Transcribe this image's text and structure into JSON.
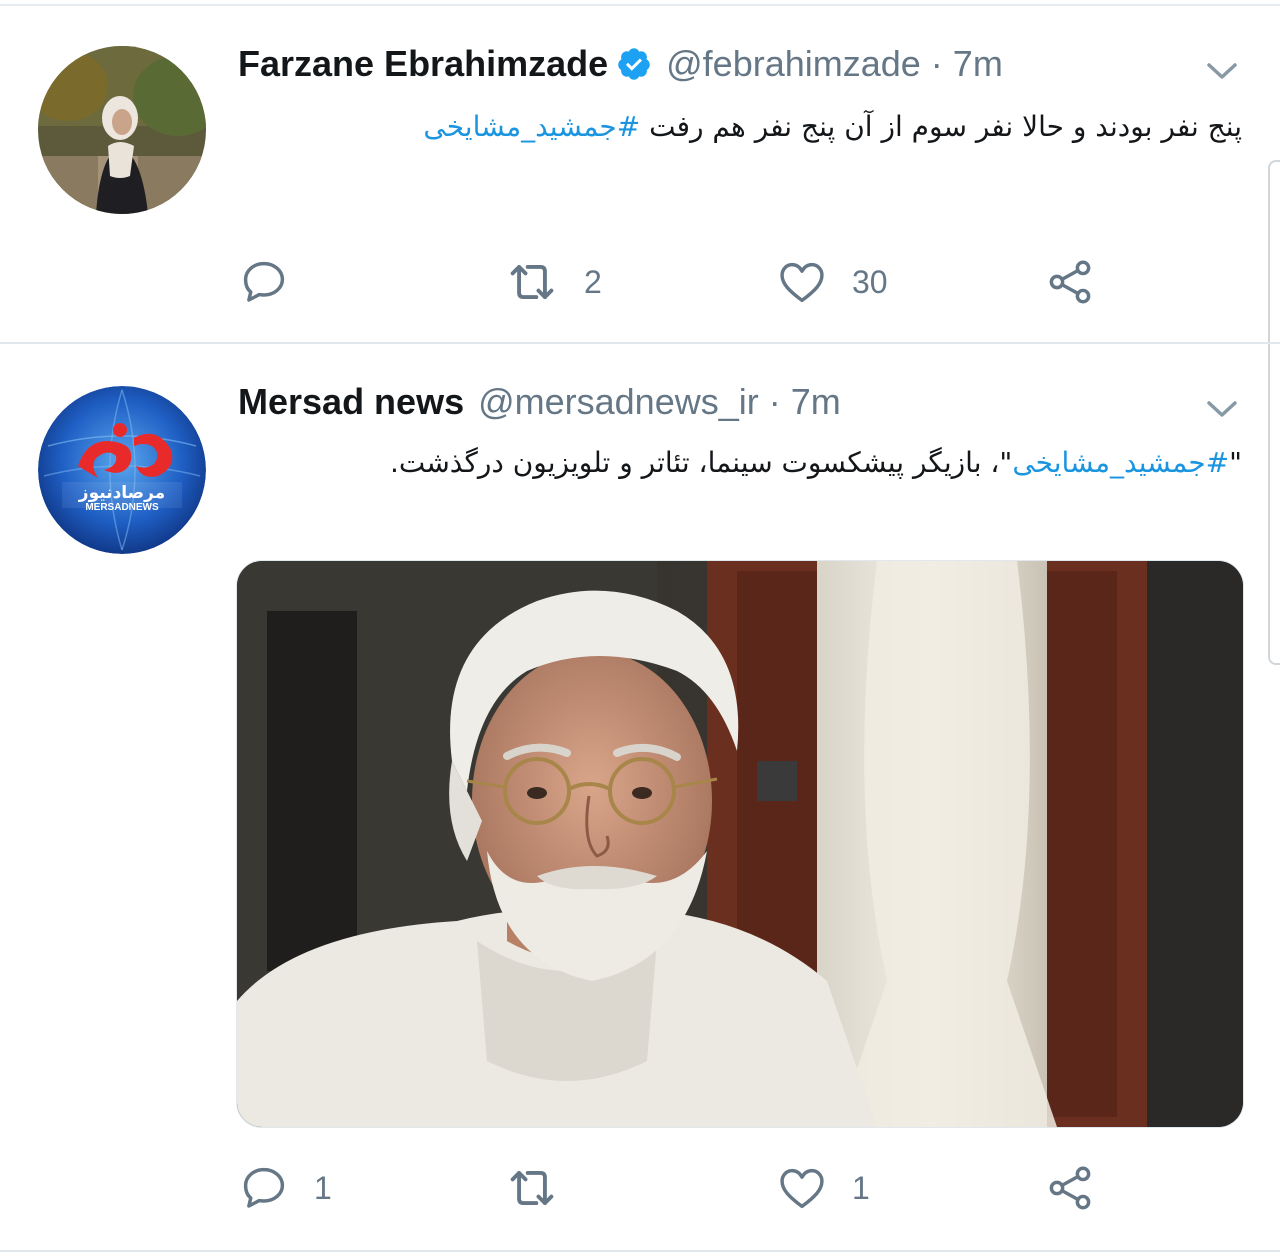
{
  "tweets": [
    {
      "author_name": "Farzane Ebrahimzade",
      "verified": true,
      "handle": "@febrahimzade",
      "separator": "·",
      "time": "7m",
      "text_plain": "پنج نفر بودند و حالا نفر سوم از آن پنج نفر هم رفت ",
      "hashtag": "#جمشید_مشایخی",
      "replies": "",
      "retweets": "2",
      "likes": "30"
    },
    {
      "author_name": "Mersad news",
      "verified": false,
      "handle": "@mersadnews_ir",
      "separator": "·",
      "time": "7m",
      "quote_open": "\"",
      "hashtag": "#جمشید_مشایخی",
      "text_rest": "\"، بازیگر پیشکسوت سینما، تئاتر و تلویزیون درگذشت.",
      "replies": "1",
      "retweets": "",
      "likes": "1",
      "avatar_logo_text": "مرصادنیوز",
      "avatar_logo_latin": "MERSADNEWS"
    }
  ],
  "colors": {
    "link": "#1b95e0",
    "secondary_text": "#657786",
    "verified": "#1da1f2",
    "divider": "#e1e8ed"
  },
  "icons": [
    "reply-icon",
    "retweet-icon",
    "like-icon",
    "share-icon",
    "verified-badge-icon",
    "chevron-down-icon"
  ]
}
